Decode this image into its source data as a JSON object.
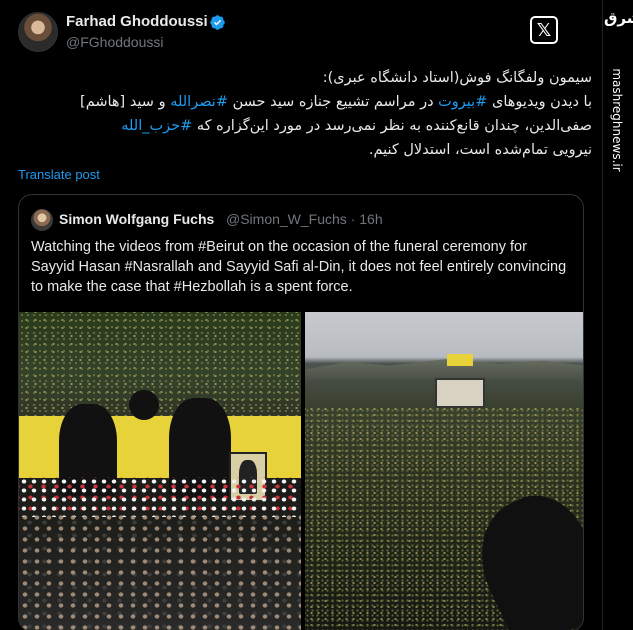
{
  "site": {
    "logo_text": "مشرق",
    "url": "mashreghnews.ir"
  },
  "tweet": {
    "author_name": "Farhad Ghoddoussi",
    "author_handle": "@FGhoddoussi",
    "verified": true,
    "body_line1": "سیمون ولفگانگ فوش(استاد دانشگاه عبری):",
    "body_line2a": "با دیدن ویدیوهای ",
    "tag_beirut": "#بیروت",
    "body_line2b": " در مراسم تشییع جنازه سید حسن ",
    "tag_nasrallah": "#نصرالله",
    "body_line2c": " و سید [هاشم]",
    "body_line3a": "صفی‌الدین، چندان قانع‌کننده به نظر نمی‌رسد در مورد این‌گزاره که ",
    "tag_hezbollah": "#حزب_الله",
    "body_line4": "نیرویی تمام‌شده است، استدلال کنیم.",
    "translate_label": "Translate post"
  },
  "quoted": {
    "author_name": "Simon Wolfgang Fuchs",
    "author_handle": "@Simon_W_Fuchs",
    "time": "· 16h",
    "text": "Watching the videos from #Beirut on the occasion of the funeral ceremony for Sayyid Hasan #Nasrallah and Sayyid Safi al-Din, it does not feel entirely convincing to make the case that #Hezbollah is a spent force."
  },
  "colors": {
    "link": "#1d9bf0",
    "verified": "#1d9bf0",
    "background": "#000000",
    "muted": "#71767b"
  },
  "icons": {
    "verified": "verified-badge-icon",
    "x_logo": "x-logo-icon"
  }
}
